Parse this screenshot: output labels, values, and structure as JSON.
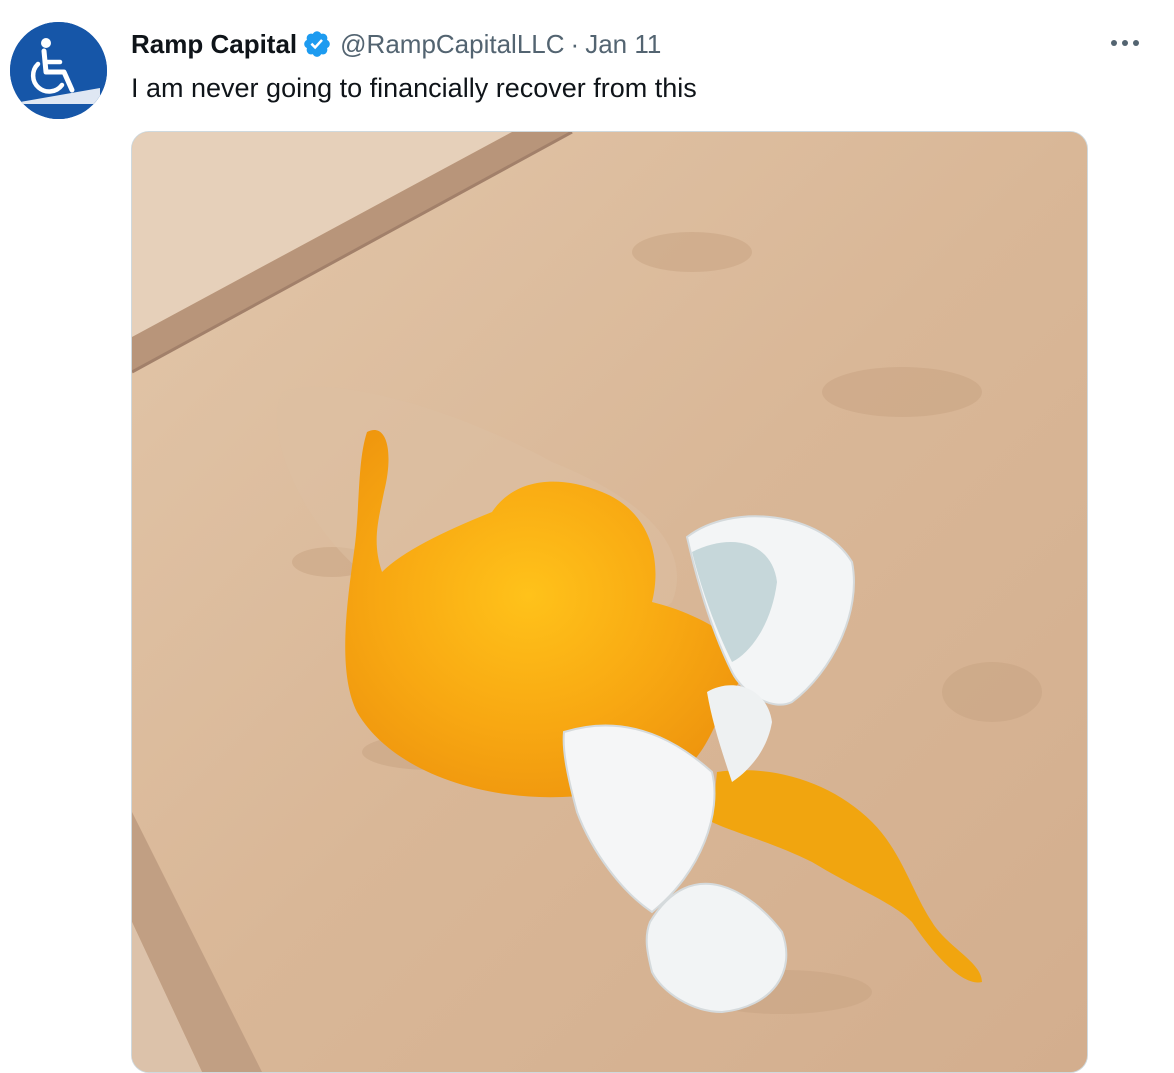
{
  "tweet": {
    "author_name": "Ramp Capital",
    "handle": "@RampCapitalLLC",
    "separator": "·",
    "date": "Jan 11",
    "text": "I am never going to financially recover from this",
    "avatar_icon": "wheelchair-ramp-icon",
    "verified_icon": "verified-badge-icon",
    "more_icon": "more-options-icon",
    "media_description_icon": "photo"
  },
  "colors": {
    "text_primary": "#0f1419",
    "text_secondary": "#536471",
    "verified_blue": "#1d9bf0",
    "avatar_blue": "#1656a8",
    "border": "#cfd9de"
  }
}
